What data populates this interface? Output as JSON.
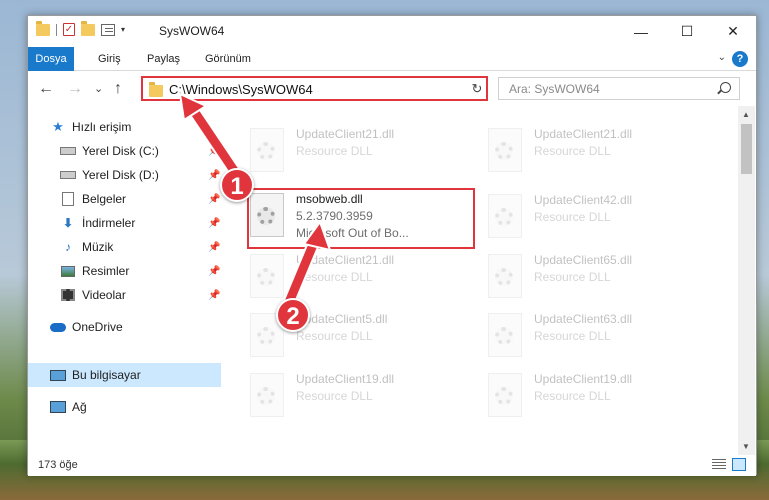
{
  "window": {
    "title": "SysWOW64",
    "controls": {
      "minimize": "—",
      "maximize": "☐",
      "close": "✕"
    }
  },
  "quick_access_toolbar": {
    "separator": "|",
    "dropdown": "▾"
  },
  "ribbon": {
    "tabs": [
      "Dosya",
      "Giriş",
      "Paylaş",
      "Görünüm"
    ],
    "help": "?"
  },
  "navigation": {
    "back": "←",
    "forward": "→",
    "recent": "⌄",
    "up": "↑",
    "address": "C:\\Windows\\SysWOW64",
    "refresh": "↻",
    "search_placeholder": "Ara: SysWOW64"
  },
  "sidebar": {
    "items": [
      {
        "label": "Hızlı erişim",
        "icon": "star-icon"
      },
      {
        "label": "Yerel Disk (C:)",
        "icon": "disk-icon",
        "pinned": true
      },
      {
        "label": "Yerel Disk (D:)",
        "icon": "disk-icon",
        "pinned": true
      },
      {
        "label": "Belgeler",
        "icon": "documents-icon",
        "pinned": true
      },
      {
        "label": "İndirmeler",
        "icon": "download-icon",
        "pinned": true
      },
      {
        "label": "Müzik",
        "icon": "music-icon",
        "pinned": true
      },
      {
        "label": "Resimler",
        "icon": "pictures-icon",
        "pinned": true
      },
      {
        "label": "Videolar",
        "icon": "video-icon",
        "pinned": true
      },
      {
        "label": "OneDrive",
        "icon": "cloud-icon"
      },
      {
        "label": "Bu bilgisayar",
        "icon": "computer-icon",
        "selected": true
      },
      {
        "label": "Ağ",
        "icon": "network-icon"
      }
    ]
  },
  "files": {
    "left": [
      {
        "name": "UpdateClient21.dll",
        "type": "Resource DLL"
      },
      {
        "name": "msobweb.dll",
        "version": "5.2.3790.3959",
        "company": "Microsoft Out of Bo..."
      },
      {
        "name": "UpdateClient21.dll",
        "type": "Resource DLL"
      },
      {
        "name": "UpdateClient5.dll",
        "type": "Resource DLL"
      },
      {
        "name": "UpdateClient19.dll",
        "type": "Resource DLL"
      }
    ],
    "right": [
      {
        "name": "UpdateClient21.dll",
        "type": "Resource DLL"
      },
      {
        "name": "UpdateClient42.dll",
        "type": "Resource DLL"
      },
      {
        "name": "UpdateClient65.dll",
        "type": "Resource DLL"
      },
      {
        "name": "UpdateClient63.dll",
        "type": "Resource DLL"
      },
      {
        "name": "UpdateClient19.dll",
        "type": "Resource DLL"
      }
    ]
  },
  "status": {
    "item_count": "173 öğe"
  },
  "annotations": {
    "step1": "1",
    "step2": "2",
    "color": "#e0353d"
  },
  "colors": {
    "accent": "#1979ca",
    "selected_bg": "#cce8ff",
    "annotation": "#e0353d"
  }
}
